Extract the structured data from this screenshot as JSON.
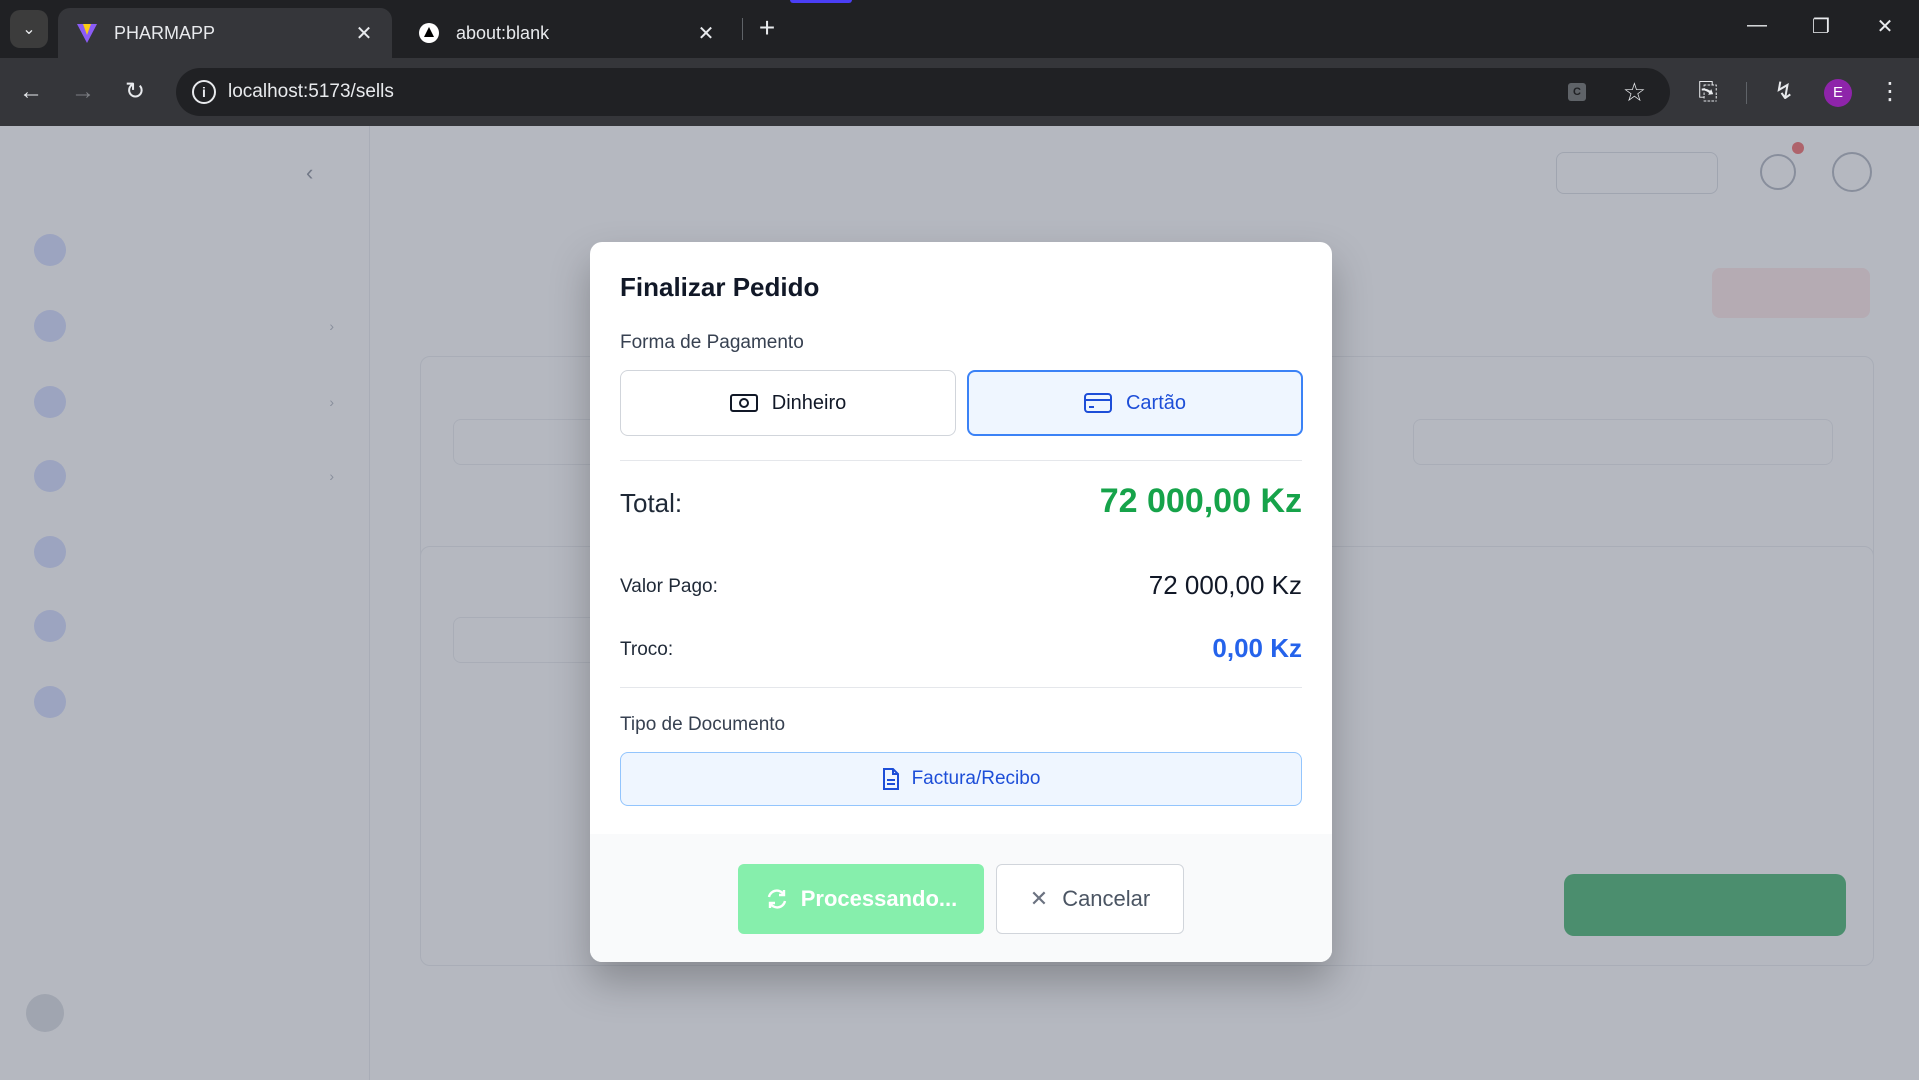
{
  "browser": {
    "tabs": [
      {
        "title": "PHARMAPP",
        "active": true
      },
      {
        "title": "about:blank",
        "active": false
      }
    ],
    "url": "localhost:5173/sells",
    "profile_initial": "E",
    "accent_color": "#4a3ef5"
  },
  "modal": {
    "title": "Finalizar Pedido",
    "payment_label": "Forma de Pagamento",
    "payment_options": [
      {
        "label": "Dinheiro",
        "icon": "cash-icon",
        "selected": false
      },
      {
        "label": "Cartão",
        "icon": "credit-card-icon",
        "selected": true
      }
    ],
    "total_label": "Total:",
    "total_value": "72 000,00 Kz",
    "paid_label": "Valor Pago:",
    "paid_value": "72 000,00 Kz",
    "change_label": "Troco:",
    "change_value": "0,00 Kz",
    "document_label": "Tipo de Documento",
    "document_option": "Factura/Recibo",
    "processing_label": "Processando...",
    "cancel_label": "Cancelar",
    "colors": {
      "total": "#16a34a",
      "change": "#2563eb",
      "selected_border": "#3b82f6",
      "processing_bg": "#86efac"
    }
  }
}
